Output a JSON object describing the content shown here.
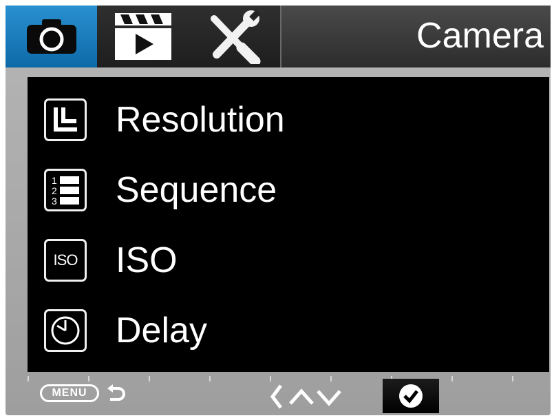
{
  "header": {
    "tabs": [
      {
        "name": "camera",
        "icon": "camera-icon",
        "active": true
      },
      {
        "name": "video",
        "icon": "clapperboard-icon",
        "active": false
      },
      {
        "name": "setup",
        "icon": "wrench-screwdriver-icon",
        "active": false
      }
    ],
    "title": "Camera"
  },
  "menu": {
    "items": [
      {
        "label": "Resolution",
        "icon": "resolution-icon"
      },
      {
        "label": "Sequence",
        "icon": "sequence-icon"
      },
      {
        "label": "ISO",
        "icon": "iso-icon",
        "icon_text": "ISO"
      },
      {
        "label": "Delay",
        "icon": "clock-icon"
      }
    ]
  },
  "footer": {
    "menu_label": "MENU",
    "back_icon": "return-arrow-icon",
    "nav_icons": [
      "chevron-left-icon",
      "chevron-up-icon",
      "chevron-down-icon"
    ],
    "ok_icon": "checkmark-icon"
  },
  "colors": {
    "active_tab": "#1a7cc0",
    "panel_background": "#000000",
    "frame": "#a8a8a8"
  }
}
